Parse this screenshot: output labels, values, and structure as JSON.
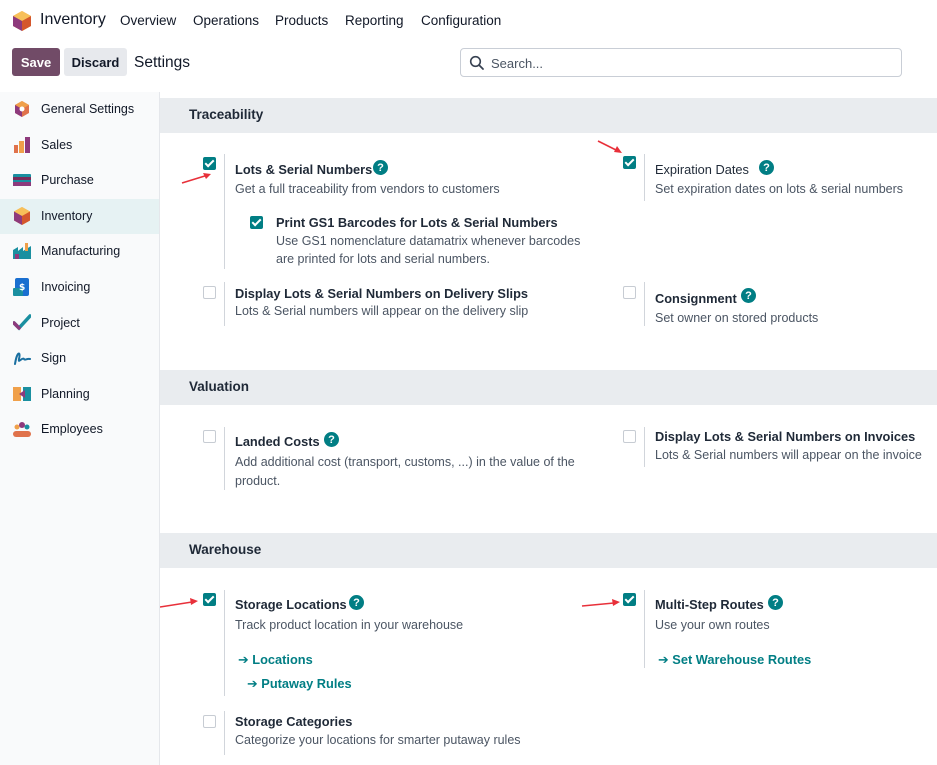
{
  "topnav": {
    "app_title": "Inventory",
    "menu": [
      "Overview",
      "Operations",
      "Products",
      "Reporting",
      "Configuration"
    ]
  },
  "control": {
    "save_label": "Save",
    "discard_label": "Discard",
    "breadcrumb": "Settings",
    "search_placeholder": "Search..."
  },
  "sidebar": {
    "items": [
      {
        "label": "General Settings",
        "icon": "general-settings-icon"
      },
      {
        "label": "Sales",
        "icon": "sales-icon"
      },
      {
        "label": "Purchase",
        "icon": "purchase-icon"
      },
      {
        "label": "Inventory",
        "icon": "inventory-icon",
        "active": true
      },
      {
        "label": "Manufacturing",
        "icon": "manufacturing-icon"
      },
      {
        "label": "Invoicing",
        "icon": "invoicing-icon"
      },
      {
        "label": "Project",
        "icon": "project-icon"
      },
      {
        "label": "Sign",
        "icon": "sign-icon"
      },
      {
        "label": "Planning",
        "icon": "planning-icon"
      },
      {
        "label": "Employees",
        "icon": "employees-icon"
      }
    ]
  },
  "traceability": {
    "header": "Traceability",
    "lots": {
      "title": "Lots & Serial Numbers",
      "desc": "Get a full traceability from vendors to customers",
      "checked": true
    },
    "gs1": {
      "title": "Print GS1 Barcodes for Lots & Serial Numbers",
      "desc1": "Use GS1 nomenclature datamatrix whenever barcodes",
      "desc2": "are printed for lots and serial numbers.",
      "checked": true
    },
    "expiration": {
      "title": "Expiration Dates",
      "desc": "Set expiration dates on lots & serial numbers",
      "checked": true
    },
    "delivery": {
      "title": "Display Lots & Serial Numbers on Delivery Slips",
      "desc": "Lots & Serial numbers will appear on the delivery slip",
      "checked": false
    },
    "consignment": {
      "title": "Consignment",
      "desc": "Set owner on stored products",
      "checked": false
    }
  },
  "valuation": {
    "header": "Valuation",
    "landed": {
      "title": "Landed Costs",
      "desc1": "Add additional cost (transport, customs, ...) in the value of the",
      "desc2": "product.",
      "checked": false
    },
    "invoices": {
      "title": "Display Lots & Serial Numbers on Invoices",
      "desc": "Lots & Serial numbers will appear on the invoice",
      "checked": false
    }
  },
  "warehouse": {
    "header": "Warehouse",
    "storage": {
      "title": "Storage Locations",
      "desc": "Track product location in your warehouse",
      "checked": true,
      "link1": "Locations",
      "link2": "Putaway Rules"
    },
    "multistep": {
      "title": "Multi-Step Routes",
      "desc": "Use your own routes",
      "checked": true,
      "link": "Set Warehouse Routes"
    },
    "categories": {
      "title": "Storage Categories",
      "desc": "Categorize your locations for smarter putaway rules",
      "checked": false
    }
  },
  "colors": {
    "brand": "#714b67",
    "accent": "#017e84",
    "arrow": "#e8303a"
  }
}
